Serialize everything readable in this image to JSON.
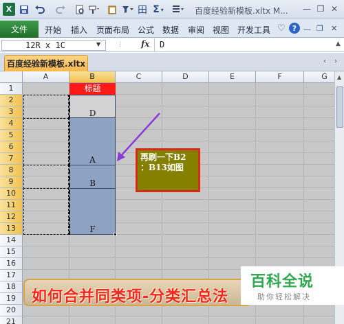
{
  "window": {
    "title": "百度经验新模板.xltx M...",
    "app_icon": "X"
  },
  "quick_access": {
    "icons": [
      "save-icon",
      "undo-icon",
      "redo-icon",
      "print-preview-icon",
      "format-painter-icon",
      "filter-icon",
      "borders-icon",
      "autosum-icon",
      "align-icon"
    ],
    "symbols": {
      "sigma": "Σ",
      "borders": "田"
    }
  },
  "ribbon": {
    "file_tab": "文件",
    "tabs": [
      "开始",
      "插入",
      "页面布局",
      "公式",
      "数据",
      "审阅",
      "视图",
      "开发工具"
    ]
  },
  "formula_bar": {
    "name_box": "12R x 1C",
    "fx_label": "fx",
    "value": "D"
  },
  "document": {
    "tab_label": "百度经验新模板.xltx"
  },
  "columns": [
    "A",
    "B",
    "C",
    "D",
    "E",
    "F",
    "G"
  ],
  "rows": [
    "1",
    "2",
    "3",
    "4",
    "5",
    "6",
    "7",
    "8",
    "9",
    "10",
    "11",
    "12",
    "13",
    "14",
    "15",
    "16",
    "17",
    "18",
    "19",
    "20",
    "21"
  ],
  "cells": {
    "b1": "标题",
    "b3": "D",
    "b7": "A",
    "b9": "B",
    "b13": "F"
  },
  "callout": {
    "line1": "再刷一下B2",
    "line2": "：B13如图"
  },
  "banner": {
    "text": "如何合并同类项-分类汇总法"
  },
  "watermark": {
    "main": "百科全说",
    "sub": "助你轻松解决"
  },
  "colors": {
    "selection_fill": "#8ea3c4",
    "header_red": "#ff1a1a",
    "callout_bg": "#868000",
    "callout_border": "#d62a1a",
    "arrow": "#8a3cd6",
    "file_tab": "#2a7f33"
  }
}
